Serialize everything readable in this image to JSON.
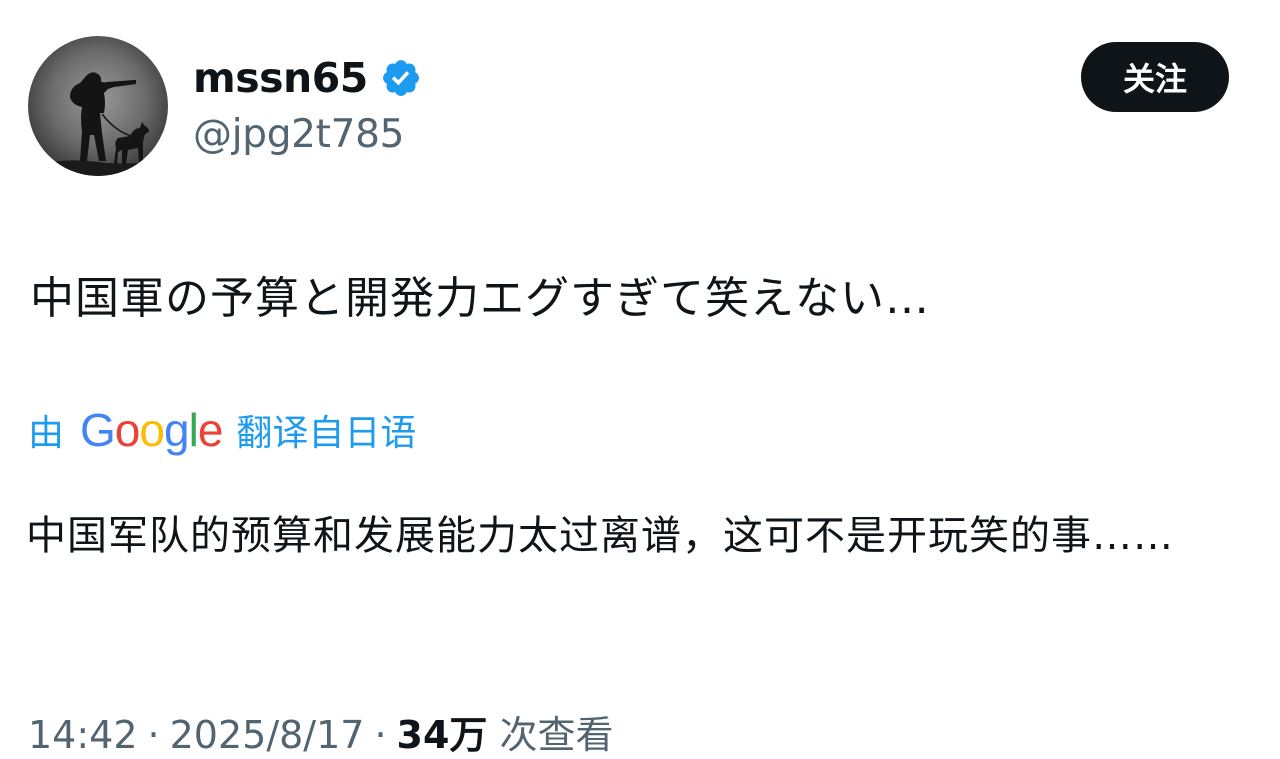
{
  "user": {
    "display_name": "mssn65",
    "handle": "@jpg2t785",
    "verified": true,
    "avatar_icon": "soldier-with-dog-silhouette-icon"
  },
  "follow_button": {
    "label": "关注"
  },
  "tweet": {
    "text": "中国軍の予算と開発力エグすぎて笑えない…"
  },
  "translation": {
    "prefix": "由",
    "provider_letters": [
      "G",
      "o",
      "o",
      "g",
      "l",
      "e"
    ],
    "suffix": "翻译自日语",
    "text": "中国军队的预算和发展能力太过离谱，这可不是开玩笑的事……"
  },
  "meta": {
    "time": "14:42",
    "date": "2025/8/17",
    "separator": "·",
    "views_count": "34万",
    "views_label": "次查看"
  },
  "colors": {
    "text_primary": "#0f1419",
    "text_secondary": "#536471",
    "link_blue": "#1d9bf0",
    "verified_blue": "#1d9bf0",
    "button_bg": "#0f1419",
    "google_blue": "#4285F4",
    "google_red": "#EA4335",
    "google_yellow": "#FBBC05",
    "google_green": "#34A853"
  }
}
